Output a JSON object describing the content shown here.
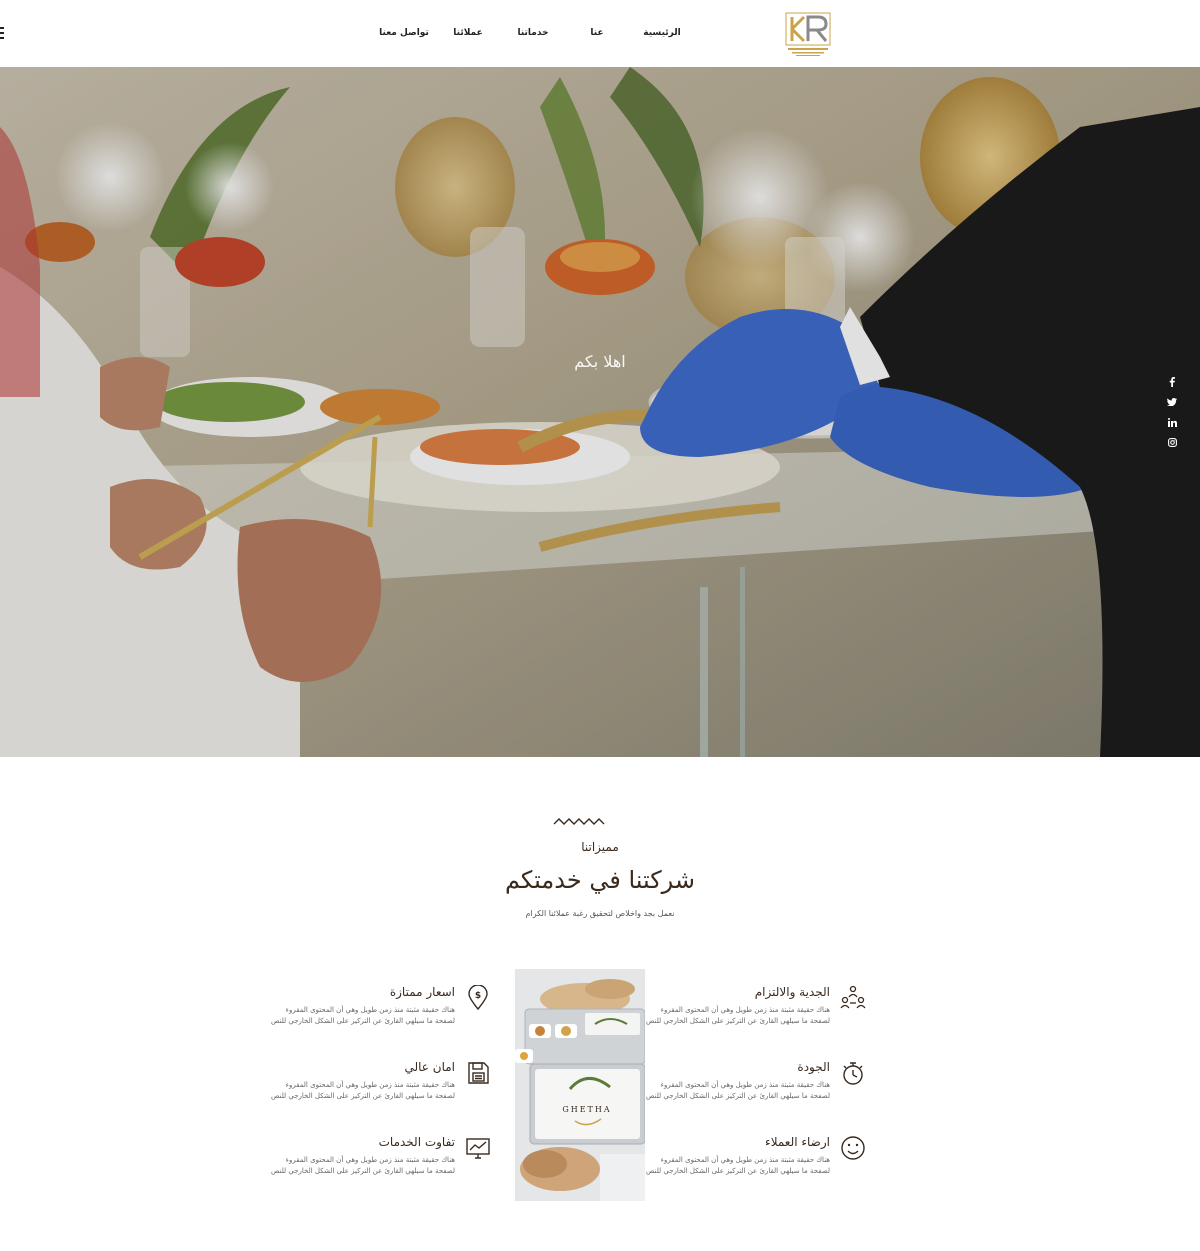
{
  "header": {
    "nav": {
      "home": "الرئيسية",
      "about": "عنا",
      "services": "خدماتنا",
      "clients": "عملائنا",
      "contact": "تواصل معنا"
    },
    "logo_icon": "brand-logo-icon",
    "menu_icon": "hamburger-menu-icon"
  },
  "hero": {
    "title": "اهلا بكم",
    "social": [
      "facebook-icon",
      "twitter-icon",
      "linkedin-icon",
      "instagram-icon"
    ]
  },
  "features": {
    "eyebrow": "مميزاتنا",
    "title": "شركتنا في خدمتكم",
    "subtitle": "نعمل بجد واخلاص لتحقيق رغبة عملائنا الكرام",
    "right": [
      {
        "title": "الجدية والالتزام",
        "icon": "team-icon",
        "text": "هناك حقيقة مثبتة منذ زمن طويل وهي أن المحتوى المقروء لصفحة ما سيلهي القارئ عن التركيز على الشكل الخارجي للنص"
      },
      {
        "title": "الجودة",
        "icon": "stopwatch-icon",
        "text": "هناك حقيقة مثبتة منذ زمن طويل وهي أن المحتوى المقروء لصفحة ما سيلهي القارئ عن التركيز على الشكل الخارجي للنص"
      },
      {
        "title": "ارضاء العملاء",
        "icon": "smiley-icon",
        "text": "هناك حقيقة مثبتة منذ زمن طويل وهي أن المحتوى المقروء لصفحة ما سيلهي القارئ عن التركيز على الشكل الخارجي للنص"
      }
    ],
    "left": [
      {
        "title": "اسعار ممتازة",
        "icon": "price-pin-icon",
        "text": "هناك حقيقة مثبتة منذ زمن طويل وهي أن المحتوى المقروء لصفحة ما سيلهي القارئ عن التركيز على الشكل الخارجي للنص"
      },
      {
        "title": "امان عالي",
        "icon": "floppy-disk-icon",
        "text": "هناك حقيقة مثبتة منذ زمن طويل وهي أن المحتوى المقروء لصفحة ما سيلهي القارئ عن التركيز على الشكل الخارجي للنص"
      },
      {
        "title": "تفاوت الخدمات",
        "icon": "monitor-chart-icon",
        "text": "هناك حقيقة مثبتة منذ زمن طويل وهي أن المحتوى المقروء لصفحة ما سيلهي القارئ عن التركيز على الشكل الخارجي للنص"
      }
    ],
    "photo_label": "GHETHA"
  }
}
